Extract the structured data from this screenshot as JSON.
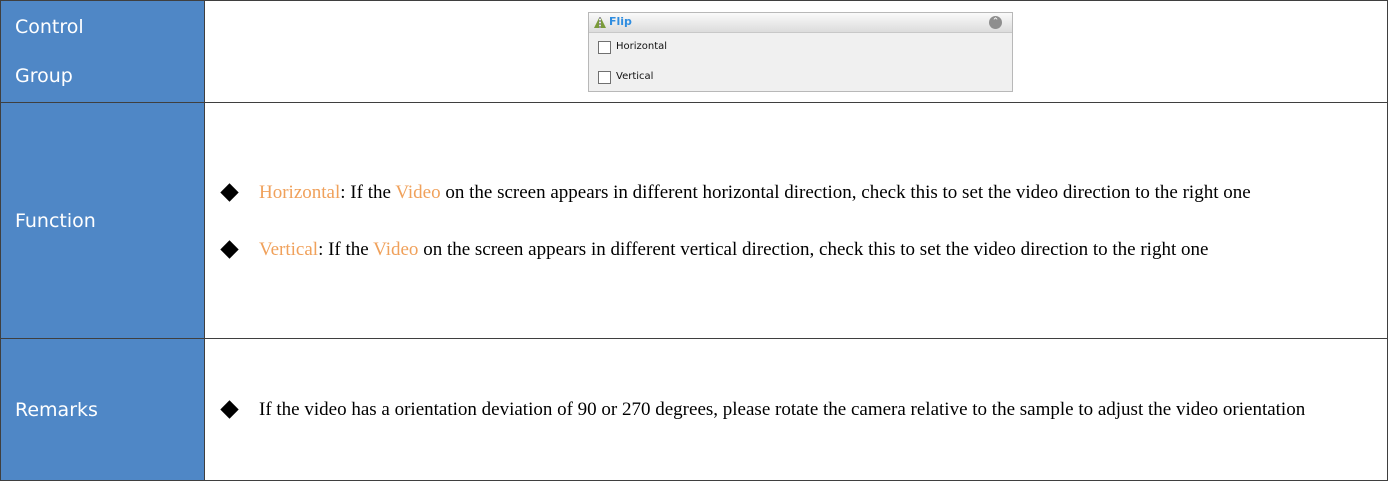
{
  "labels": {
    "control_group_line1": "Control",
    "control_group_line2": "Group",
    "function": "Function",
    "remarks": "Remarks"
  },
  "flip_panel": {
    "title": "Flip",
    "options": [
      {
        "label": "Horizontal",
        "checked": false
      },
      {
        "label": "Vertical",
        "checked": false
      }
    ],
    "icons": [
      "flip-icon",
      "collapse-icon"
    ]
  },
  "function": {
    "items": [
      {
        "term": "Horizontal",
        "part1": ": If the ",
        "video": "Video",
        "part2": " on the screen appears in different horizontal direction, check this to set the video direction to the right one"
      },
      {
        "term": "Vertical",
        "part1": ": If the ",
        "video": "Video",
        "part2": " on the screen appears in different vertical direction, check this to set the video direction to the right one"
      }
    ]
  },
  "remarks": {
    "items": [
      {
        "text": "If the video has a orientation deviation of 90 or 270 degrees, please rotate the camera relative to the sample to adjust the video orientation"
      }
    ]
  },
  "colors": {
    "label_background": "#4f87c6",
    "label_text": "#ffffff",
    "highlight": "#f0a15b",
    "flip_title": "#2f8de0"
  }
}
